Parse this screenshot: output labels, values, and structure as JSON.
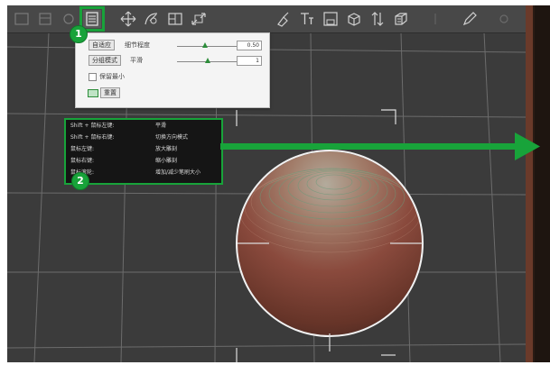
{
  "toolbar": {
    "icons": [
      "frame-all-icon",
      "curve-icon",
      "layers-icon",
      "expand-icon",
      "ruler-icon",
      "brush-icon",
      "text-size-icon",
      "save-icon",
      "cube-icon",
      "arrows-icon",
      "grid-box-icon",
      "pencil-icon"
    ],
    "accent": "#18a33a"
  },
  "popup": {
    "button1": "自适应",
    "label1": "细节程度",
    "button2": "分组模式",
    "label2": "平滑",
    "value1": "0.50",
    "value2": "1",
    "slider1_level": 0.45,
    "slider2_level": 0.5,
    "checkbox_label": "保留最小",
    "apply_label": "重置"
  },
  "legend": {
    "rows": [
      {
        "key": "Shift + 鼠标左键:",
        "value": "平滑"
      },
      {
        "key": "Shift + 鼠标右键:",
        "value": "切换方向模式"
      },
      {
        "key": "鼠标左键:",
        "value": "放大雕刻"
      },
      {
        "key": "鼠标右键:",
        "value": "缩小雕刻"
      },
      {
        "key": "鼠标滚轮:",
        "value": "增加/减少笔刷大小"
      }
    ]
  },
  "annotations": {
    "badge1": "1",
    "badge2": "2"
  },
  "colors": {
    "viewport_bg": "#3b3b3b",
    "sphere_top": "#a99b86",
    "sphere_mid": "#8e4a3c",
    "sphere_bottom": "#4e2a24"
  }
}
